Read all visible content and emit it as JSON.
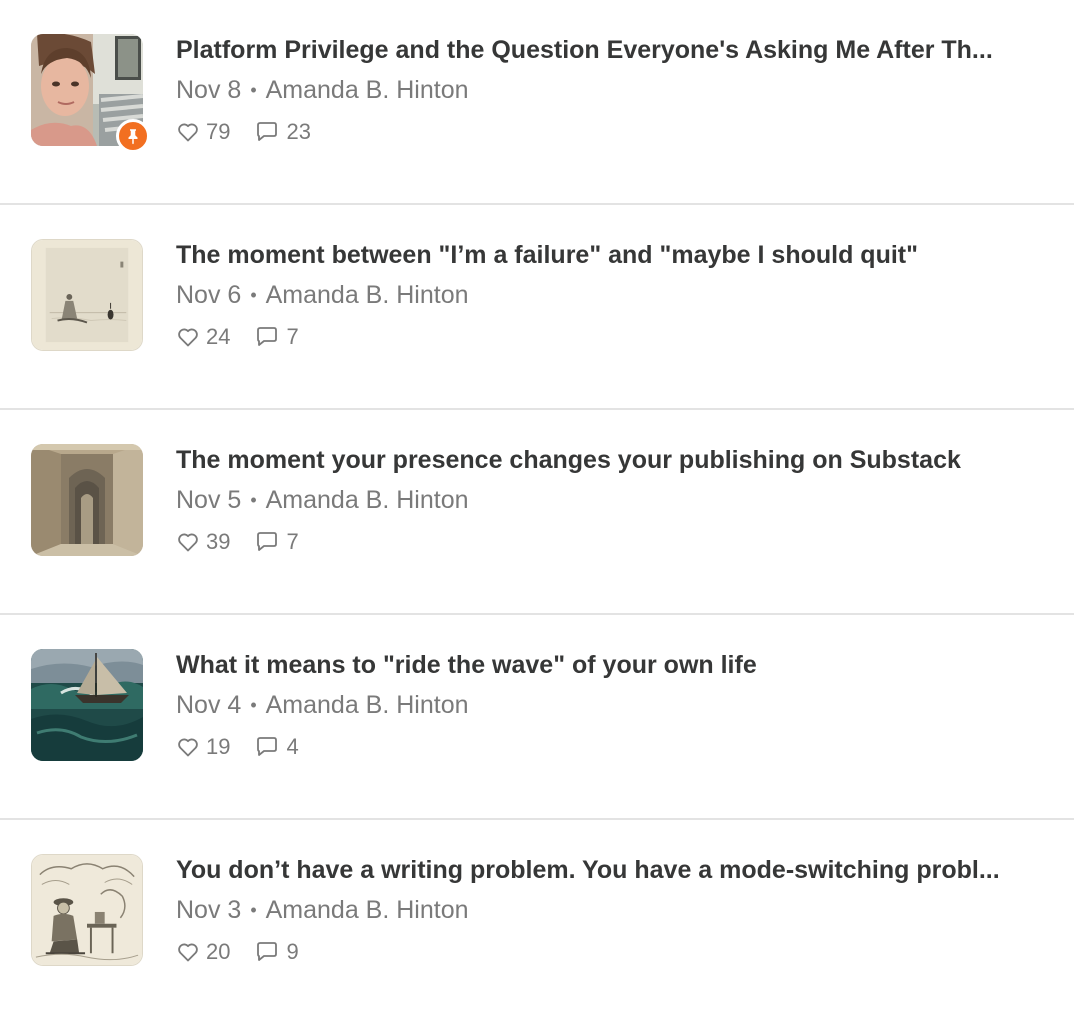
{
  "posts": [
    {
      "title": "Platform Privilege and the Question Everyone's Asking Me After Th...",
      "date": "Nov 8",
      "author": "Amanda B. Hinton",
      "likes": "79",
      "comments": "23",
      "pinned": true,
      "thumbnail": "portrait-photo"
    },
    {
      "title": "The moment between \"I’m a failure\" and \"maybe I should quit\"",
      "date": "Nov 6",
      "author": "Amanda B. Hinton",
      "likes": "24",
      "comments": "7",
      "pinned": false,
      "thumbnail": "sketch-figure-by-water"
    },
    {
      "title": "The moment your presence changes your publishing on Substack",
      "date": "Nov 5",
      "author": "Amanda B. Hinton",
      "likes": "39",
      "comments": "7",
      "pinned": false,
      "thumbnail": "watercolor-archway-corridor"
    },
    {
      "title": "What it means to \"ride the wave\" of your own life",
      "date": "Nov 4",
      "author": "Amanda B. Hinton",
      "likes": "19",
      "comments": "4",
      "pinned": false,
      "thumbnail": "painting-sailboat-waves"
    },
    {
      "title": "You don’t have a writing problem. You have a mode-switching probl...",
      "date": "Nov 3",
      "author": "Amanda B. Hinton",
      "likes": "20",
      "comments": "9",
      "pinned": false,
      "thumbnail": "engraving-man-at-desk"
    }
  ],
  "colors": {
    "title": "#363737",
    "meta": "#7a7a7a",
    "divider": "#e3e3e3",
    "pin_badge": "#f26f21"
  },
  "icons": {
    "like": "heart-icon",
    "comment": "comment-bubble-icon",
    "pin": "pin-icon"
  }
}
